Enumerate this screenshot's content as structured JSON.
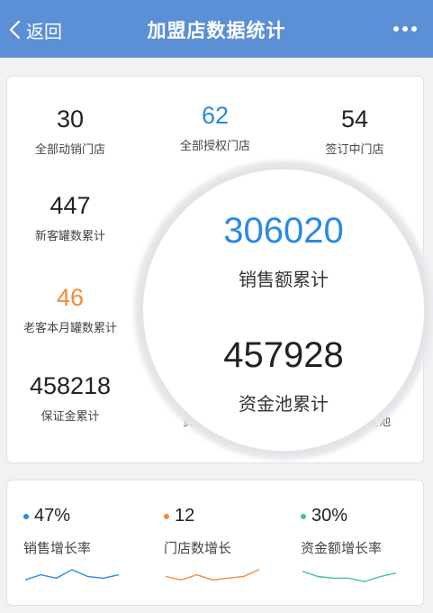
{
  "nav": {
    "back_label": "返回",
    "title": "加盟店数据统计"
  },
  "stats": [
    {
      "value": "30",
      "label": "全部动销门店",
      "color": "#222222"
    },
    {
      "value": "62",
      "label": "全部授权门店",
      "color": "#2a8ae0"
    },
    {
      "value": "54",
      "label": "签订中门店",
      "color": "#222222"
    },
    {
      "value": "447",
      "label": "新客罐数累计",
      "color": "#222222"
    },
    {
      "value": "46",
      "label": "老客本月罐数累计",
      "color": "#f08a3c"
    },
    {
      "value": "458218",
      "label": "保证金累计",
      "color": "#222222"
    }
  ],
  "hidden_partial": {
    "left_label": "资",
    "right_label": "金池"
  },
  "magnifier": {
    "sales_value": "306020",
    "sales_label": "销售额累计",
    "pool_value": "457928",
    "pool_label": "资金池累计"
  },
  "trends": [
    {
      "value": "47%",
      "label": "销售增长率",
      "color": "#2a8ae0",
      "points": [
        3,
        6,
        4,
        9,
        5,
        4,
        6
      ]
    },
    {
      "value": "12",
      "label": "门店数增长",
      "color": "#f08a3c",
      "points": [
        5,
        3,
        6,
        3,
        4,
        5,
        9
      ]
    },
    {
      "value": "30%",
      "label": "资金额增长率",
      "color": "#3cc2a4",
      "points": [
        8,
        5,
        4,
        4,
        2,
        5,
        7
      ]
    }
  ]
}
